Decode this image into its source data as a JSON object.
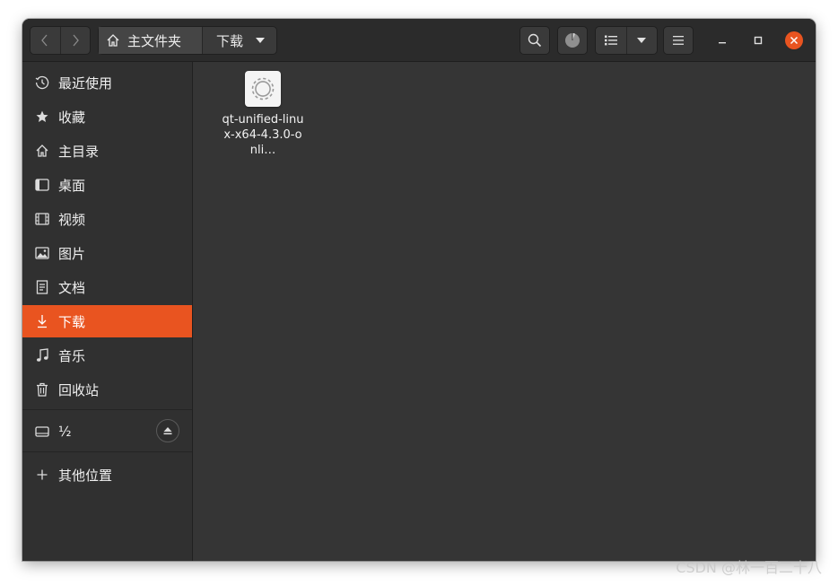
{
  "pathbar": {
    "home_label": "主文件夹",
    "current_label": "下载"
  },
  "sidebar": {
    "items": [
      {
        "label": "最近使用",
        "icon": "clock-icon"
      },
      {
        "label": "收藏",
        "icon": "star-icon"
      },
      {
        "label": "主目录",
        "icon": "home-icon"
      },
      {
        "label": "桌面",
        "icon": "desktop-icon"
      },
      {
        "label": "视频",
        "icon": "film-icon"
      },
      {
        "label": "图片",
        "icon": "image-icon"
      },
      {
        "label": "文档",
        "icon": "document-icon"
      },
      {
        "label": "下载",
        "icon": "download-icon",
        "active": true
      },
      {
        "label": "音乐",
        "icon": "music-icon"
      },
      {
        "label": "回收站",
        "icon": "trash-icon"
      }
    ],
    "device": {
      "label": "½",
      "icon": "drive-icon"
    },
    "other_locations": {
      "label": "其他位置",
      "icon": "plus-icon"
    }
  },
  "files": [
    {
      "name": "qt-unified-linux-x64-4.3.0-onli…",
      "icon": "executable-gear-icon"
    }
  ],
  "watermark": "CSDN @林一百二十八",
  "colors": {
    "accent": "#e95420",
    "window_bg": "#333333",
    "sidebar_bg": "#303030",
    "header_bg": "#2b2b2b"
  }
}
